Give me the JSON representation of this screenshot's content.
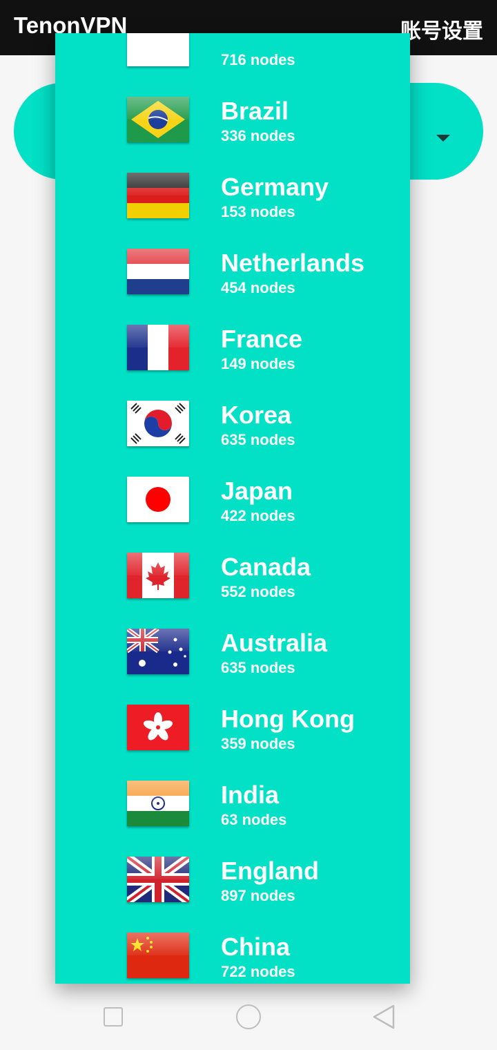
{
  "app": {
    "title": "TenonVPN",
    "account_label": "账号设置"
  },
  "selector": {
    "accent": "#02e0c6"
  },
  "countries": [
    {
      "name": "",
      "nodes": "716 nodes",
      "flag": "partial-flag"
    },
    {
      "name": "Brazil",
      "nodes": "336 nodes",
      "flag": "flag-brazil"
    },
    {
      "name": "Germany",
      "nodes": "153 nodes",
      "flag": "flag-germany"
    },
    {
      "name": "Netherlands",
      "nodes": "454 nodes",
      "flag": "flag-netherlands"
    },
    {
      "name": "France",
      "nodes": "149 nodes",
      "flag": "flag-france"
    },
    {
      "name": "Korea",
      "nodes": "635 nodes",
      "flag": "flag-korea"
    },
    {
      "name": "Japan",
      "nodes": "422 nodes",
      "flag": "flag-japan"
    },
    {
      "name": "Canada",
      "nodes": "552 nodes",
      "flag": "flag-canada"
    },
    {
      "name": "Australia",
      "nodes": "635 nodes",
      "flag": "flag-australia"
    },
    {
      "name": "Hong Kong",
      "nodes": "359 nodes",
      "flag": "flag-hongkong"
    },
    {
      "name": "India",
      "nodes": "63 nodes",
      "flag": "flag-india"
    },
    {
      "name": "England",
      "nodes": "897 nodes",
      "flag": "flag-uk"
    },
    {
      "name": "China",
      "nodes": "722 nodes",
      "flag": "flag-china"
    }
  ],
  "navbar": {
    "recent": "square-icon",
    "home": "circle-icon",
    "back": "back-triangle-icon"
  }
}
